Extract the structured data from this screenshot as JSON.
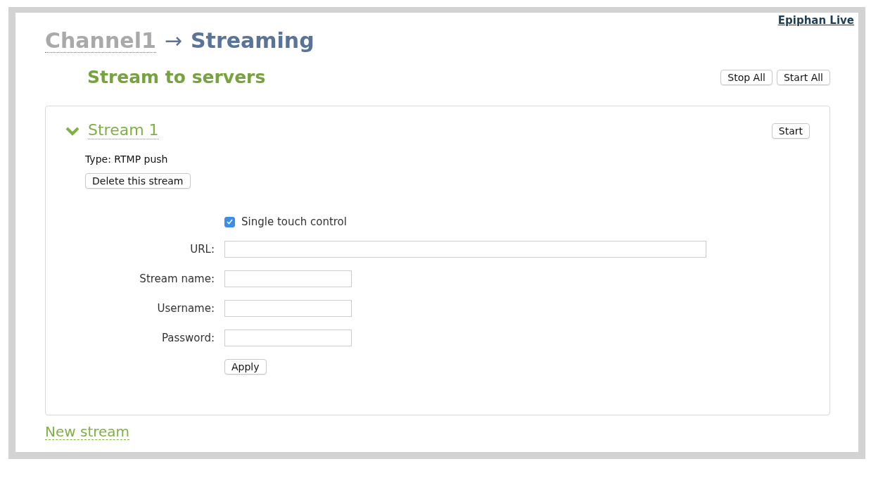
{
  "top_link": "Epiphan Live",
  "breadcrumb": {
    "parent": "Channel1",
    "separator": "→",
    "current": "Streaming"
  },
  "section": {
    "title": "Stream to servers",
    "buttons": [
      "Stop All",
      "Start All"
    ]
  },
  "stream": {
    "title": "Stream 1",
    "expanded": true,
    "start_button": "Start",
    "type_text": "Type: RTMP push",
    "delete_button": "Delete this stream",
    "single_touch": {
      "label": "Single touch control",
      "checked": true
    },
    "fields": [
      {
        "label": "URL:",
        "kind": "wide"
      },
      {
        "label": "Stream name:",
        "kind": "short"
      },
      {
        "label": "Username:",
        "kind": "short"
      },
      {
        "label": "Password:",
        "kind": "short"
      }
    ],
    "apply_button": "Apply"
  },
  "new_stream": "New stream"
}
